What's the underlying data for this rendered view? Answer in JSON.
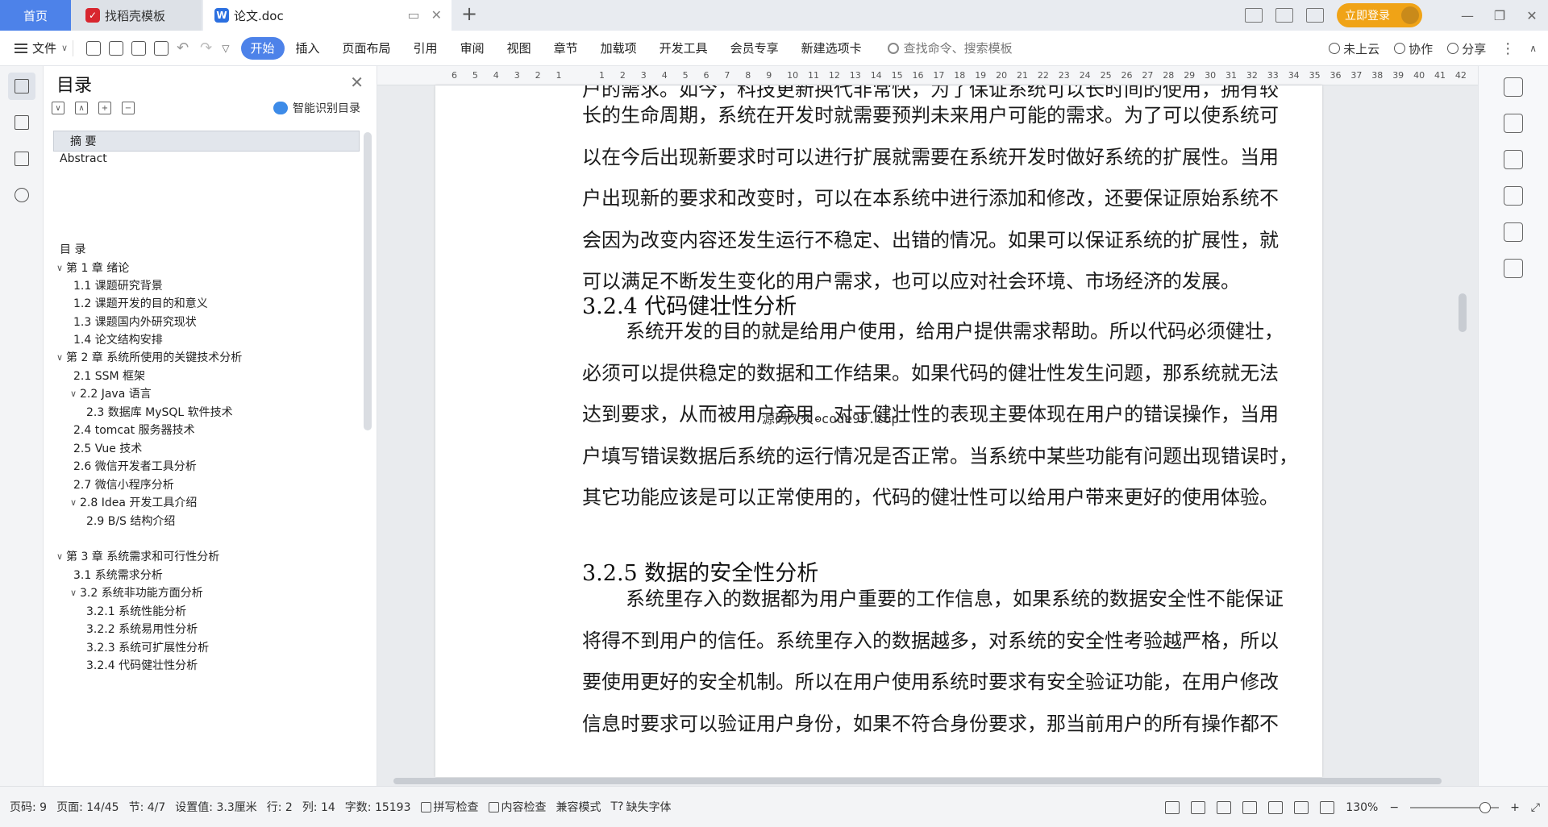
{
  "tabs": {
    "home": "首页",
    "daoke": "找稻壳模板",
    "doc": "论文.doc"
  },
  "title_right": {
    "login": "立即登录"
  },
  "menu": {
    "file": "文件",
    "tabs": [
      "开始",
      "插入",
      "页面布局",
      "引用",
      "审阅",
      "视图",
      "章节",
      "加载项",
      "开发工具",
      "会员专享",
      "新建选项卡"
    ],
    "search_placeholder": "查找命令、搜索模板",
    "cloud": "未上云",
    "collab": "协作",
    "share": "分享"
  },
  "toc": {
    "title": "目录",
    "smart": "智能识别目录",
    "items": [
      {
        "label": "摘  要",
        "level": 1,
        "caret": "",
        "selected": true
      },
      {
        "label": "Abstract",
        "level": 0,
        "caret": ""
      },
      {
        "label": "目  录",
        "level": 0,
        "caret": ""
      },
      {
        "label": "第 1 章  绪论",
        "level": 0,
        "caret": "v"
      },
      {
        "label": "1.1    课题研究背景",
        "level": 1,
        "caret": ""
      },
      {
        "label": "1.2  课题开发的目的和意义",
        "level": 1,
        "caret": ""
      },
      {
        "label": "1.3    课题国内外研究现状",
        "level": 1,
        "caret": ""
      },
      {
        "label": "1.4  论文结构安排",
        "level": 1,
        "caret": ""
      },
      {
        "label": "第 2 章  系统所使用的关键技术分析",
        "level": 0,
        "caret": "v"
      },
      {
        "label": "2.1 SSM 框架",
        "level": 1,
        "caret": ""
      },
      {
        "label": "2.2 Java 语言",
        "level": 1,
        "caret": "v"
      },
      {
        "label": "2.3  数据库 MySQL 软件技术",
        "level": 2,
        "caret": ""
      },
      {
        "label": "2.4 tomcat 服务器技术",
        "level": 1,
        "caret": ""
      },
      {
        "label": "2.5 Vue 技术",
        "level": 1,
        "caret": ""
      },
      {
        "label": "2.6  微信开发者工具分析",
        "level": 1,
        "caret": ""
      },
      {
        "label": "2.7 微信小程序分析",
        "level": 1,
        "caret": ""
      },
      {
        "label": "2.8 Idea 开发工具介绍",
        "level": 1,
        "caret": "v"
      },
      {
        "label": "2.9 B/S 结构介绍",
        "level": 2,
        "caret": ""
      },
      {
        "label": "第 3 章  系统需求和可行性分析",
        "level": 0,
        "caret": "v"
      },
      {
        "label": "3.1 系统需求分析",
        "level": 1,
        "caret": ""
      },
      {
        "label": "3.2 系统非功能方面分析",
        "level": 1,
        "caret": "v"
      },
      {
        "label": "3.2.1 系统性能分析",
        "level": 2,
        "caret": ""
      },
      {
        "label": "3.2.2 系统易用性分析",
        "level": 2,
        "caret": ""
      },
      {
        "label": "3.2.3 系统可扩展性分析",
        "level": 2,
        "caret": ""
      },
      {
        "label": "3.2.4 代码健壮性分析",
        "level": 2,
        "caret": ""
      }
    ]
  },
  "doc": {
    "para_top_cut": "户的需求。如今，科技更新换代非常快，为了保证系统可以长时间的使用，拥有较",
    "para1": [
      "长的生命周期，系统在开发时就需要预判未来用户可能的需求。为了可以使系统可",
      "以在今后出现新要求时可以进行扩展就需要在系统开发时做好系统的扩展性。当用",
      "户出现新的要求和改变时，可以在本系统中进行添加和修改，还要保证原始系统不",
      "会因为改变内容还发生运行不稳定、出错的情况。如果可以保证系统的扩展性，就",
      "可以满足不断发生变化的用户需求，也可以应对社会环境、市场经济的发展。"
    ],
    "heading1": "3.2.4 代码健壮性分析",
    "para2": [
      "系统开发的目的就是给用户使用，给用户提供需求帮助。所以代码必须健壮，",
      "必须可以提供稳定的数据和工作结果。如果代码的健壮性发生问题，那系统就无法",
      "达到要求，从而被用户弃用。对于健壮性的表现主要体现在用户的错误操作，当用",
      "户填写错误数据后系统的运行情况是否正常。当系统中某些功能有问题出现错误时，",
      "其它功能应该是可以正常使用的，代码的健壮性可以给用户带来更好的使用体验。"
    ],
    "heading2": "3.2.5 数据的安全性分析",
    "para3": [
      "系统里存入的数据都为用户重要的工作信息，如果系统的数据安全性不能保证",
      "将得不到用户的信任。系统里存入的数据越多，对系统的安全性考验越严格，所以",
      "要使用更好的安全机制。所以在用户使用系统时要求有安全验证功能，在用户修改",
      "信息时要求可以验证用户身份，如果不符合身份要求，那当前用户的所有操作都不"
    ],
    "watermark": "源码久久-code99.top"
  },
  "ruler": {
    "left_numbers": [
      "6",
      "5",
      "4",
      "3",
      "2",
      "1"
    ],
    "right_numbers": [
      "1",
      "2",
      "3",
      "4",
      "5",
      "6",
      "7",
      "8",
      "9",
      "10",
      "11",
      "12",
      "13",
      "14",
      "15",
      "16",
      "17",
      "18",
      "19",
      "20",
      "21",
      "22",
      "23",
      "24",
      "25",
      "26",
      "27",
      "28",
      "29",
      "30",
      "31",
      "32",
      "33",
      "34",
      "35",
      "36",
      "37",
      "38",
      "39",
      "40",
      "41",
      "42"
    ]
  },
  "status": {
    "page_code": "页码: 9",
    "page": "页面: 14/45",
    "section": "节: 4/7",
    "setting": "设置值: 3.3厘米",
    "row": "行: 2",
    "col": "列: 14",
    "words": "字数: 15193",
    "spell": "拼写检查",
    "content_check": "内容检查",
    "compat": "兼容模式",
    "missing_font": "缺失字体",
    "zoom": "130%"
  }
}
